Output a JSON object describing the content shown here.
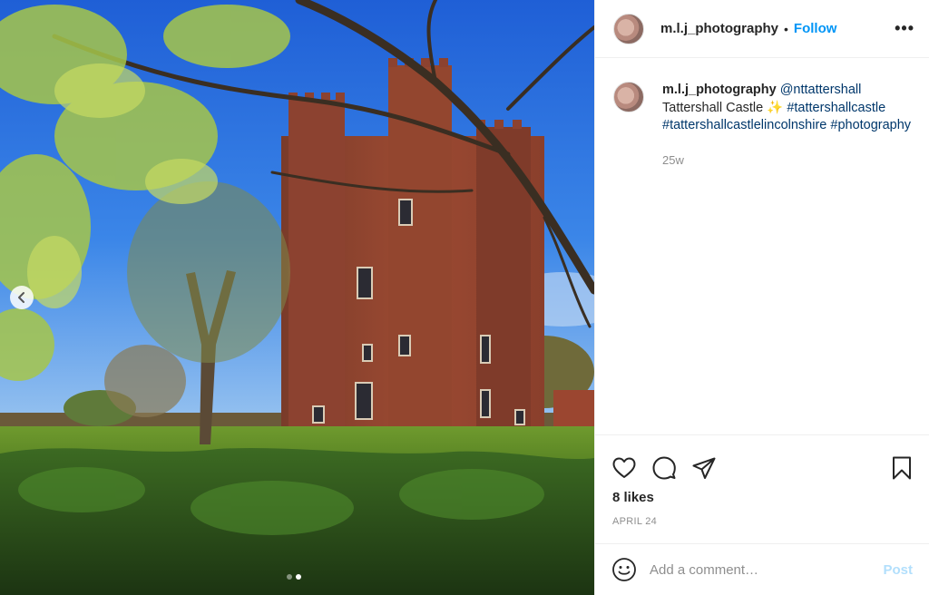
{
  "post": {
    "username": "m.l.j_photography",
    "separator": "•",
    "follow_label": "Follow",
    "more_label": "•••"
  },
  "caption": {
    "username": "m.l.j_photography",
    "mention": "@nttattershall",
    "text": "Tattershall Castle",
    "sparkle": "✨",
    "hashtags": [
      "#tattershallcastle",
      "#tattershallcastlelincolnshire",
      "#photography"
    ],
    "time": "25w"
  },
  "stats": {
    "likes": "8 likes",
    "date": "APRIL 24"
  },
  "comment": {
    "placeholder": "Add a comment…",
    "post_label": "Post"
  },
  "carousel": {
    "slide_count": 2,
    "active_index": 1
  },
  "colors": {
    "link_blue": "#0095f6",
    "hashtag_blue": "#00376b",
    "post_disabled": "#b2dffc",
    "muted": "#8e8e8e"
  },
  "icons": [
    "chevron-left-icon",
    "heart-icon",
    "comment-icon",
    "share-icon",
    "bookmark-icon",
    "emoji-icon",
    "more-icon"
  ]
}
